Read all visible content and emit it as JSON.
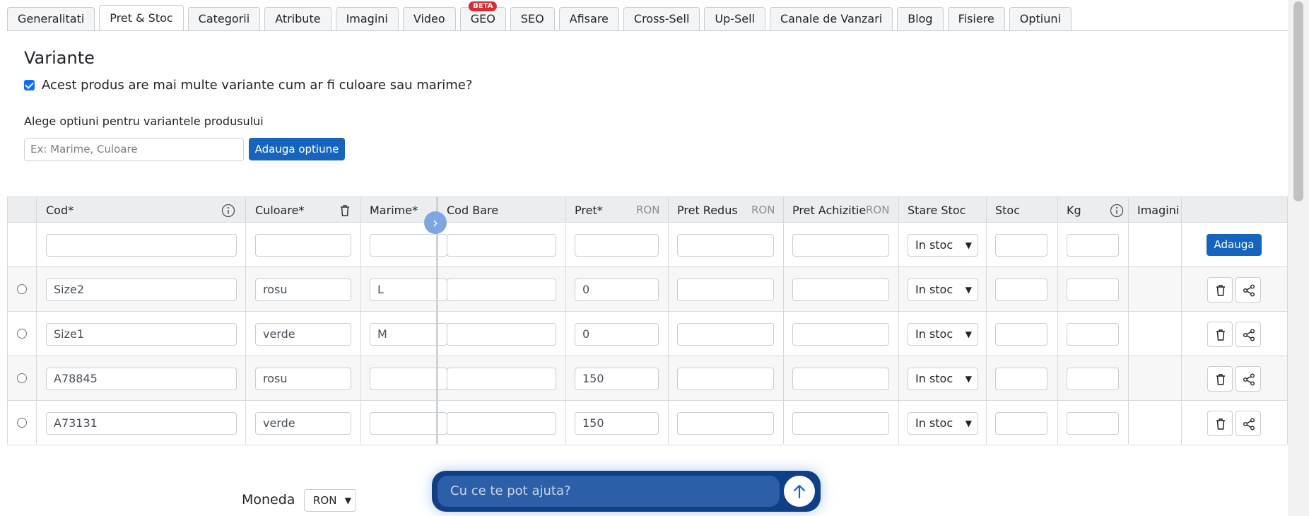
{
  "tabs": [
    {
      "label": "Generalitati"
    },
    {
      "label": "Pret & Stoc",
      "active": true
    },
    {
      "label": "Categorii"
    },
    {
      "label": "Atribute"
    },
    {
      "label": "Imagini"
    },
    {
      "label": "Video"
    },
    {
      "label": "GEO",
      "badge": "BETA"
    },
    {
      "label": "SEO"
    },
    {
      "label": "Afisare"
    },
    {
      "label": "Cross-Sell"
    },
    {
      "label": "Up-Sell"
    },
    {
      "label": "Canale de Vanzari"
    },
    {
      "label": "Blog"
    },
    {
      "label": "Fisiere"
    },
    {
      "label": "Optiuni"
    }
  ],
  "variants": {
    "title": "Variante",
    "has_variants_label": "Acest produs are mai multe variante cum ar fi culoare sau marime?",
    "has_variants_checked": true,
    "options_label": "Alege optiuni pentru variantele produsului",
    "options_placeholder": "Ex: Marime, Culoare",
    "add_option_label": "Adauga optiune"
  },
  "table": {
    "headers": {
      "cod": "Cod*",
      "culoare": "Culoare*",
      "marime": "Marime*",
      "cod_bare": "Cod Bare",
      "pret": "Pret*",
      "pret_redus": "Pret Redus",
      "pret_achizitie": "Pret Achizitie",
      "stare_stoc": "Stare Stoc",
      "stoc": "Stoc",
      "kg": "Kg",
      "imagini": "Imagini"
    },
    "currency_unit": "RON",
    "new_row": {
      "stare_stoc": "In stoc",
      "add_label": "Adauga"
    },
    "rows": [
      {
        "cod": "Size2",
        "culoare": "rosu",
        "marime": "L",
        "cod_bare": "",
        "pret": "0",
        "pret_redus": "",
        "pret_achizitie": "",
        "stare_stoc": "In stoc",
        "stoc": "",
        "kg": ""
      },
      {
        "cod": "Size1",
        "culoare": "verde",
        "marime": "M",
        "cod_bare": "",
        "pret": "0",
        "pret_redus": "",
        "pret_achizitie": "",
        "stare_stoc": "In stoc",
        "stoc": "",
        "kg": ""
      },
      {
        "cod": "A78845",
        "culoare": "rosu",
        "marime": "",
        "cod_bare": "",
        "pret": "150",
        "pret_redus": "",
        "pret_achizitie": "",
        "stare_stoc": "In stoc",
        "stoc": "",
        "kg": ""
      },
      {
        "cod": "A73131",
        "culoare": "verde",
        "marime": "",
        "cod_bare": "",
        "pret": "150",
        "pret_redus": "",
        "pret_achizitie": "",
        "stare_stoc": "In stoc",
        "stoc": "",
        "kg": ""
      }
    ]
  },
  "moneda": {
    "label": "Moneda",
    "value": "RON"
  },
  "chat": {
    "placeholder": "Cu ce te pot ajuta?"
  },
  "colors": {
    "primary": "#1565c0",
    "badge": "#e0292e",
    "chat_bg": "#0f3f86"
  },
  "icons": {
    "info": "info-icon",
    "trash": "trash-icon",
    "share": "share-icon",
    "send": "arrow-up-icon",
    "expand": "chevron-right-icon"
  }
}
